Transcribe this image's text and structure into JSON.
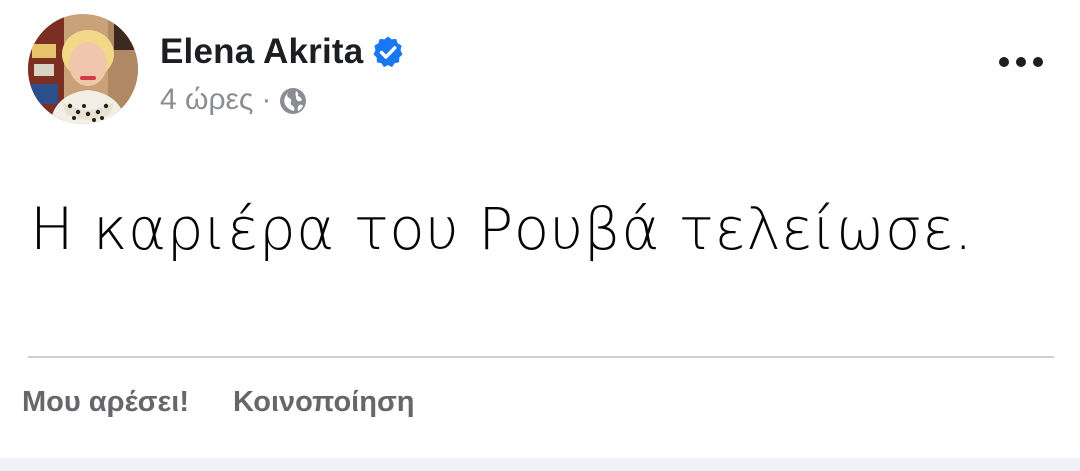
{
  "post": {
    "author_name": "Elena Akrita",
    "verified": true,
    "timestamp": "4 ώρες",
    "separator": "·",
    "privacy_icon": "globe-icon",
    "body_text": "Η καριέρα του Ρουβά τελείωσε."
  },
  "actions": {
    "like_label": "Μου αρέσει!",
    "share_label": "Κοινοποίηση"
  },
  "colors": {
    "verified_badge": "#1877f2",
    "meta_text": "#8a8d91",
    "action_text": "#65676b",
    "divider": "#ced0d4"
  },
  "icons": {
    "verified": "verified-badge-icon",
    "more": "more-options-icon",
    "privacy": "globe-icon"
  }
}
